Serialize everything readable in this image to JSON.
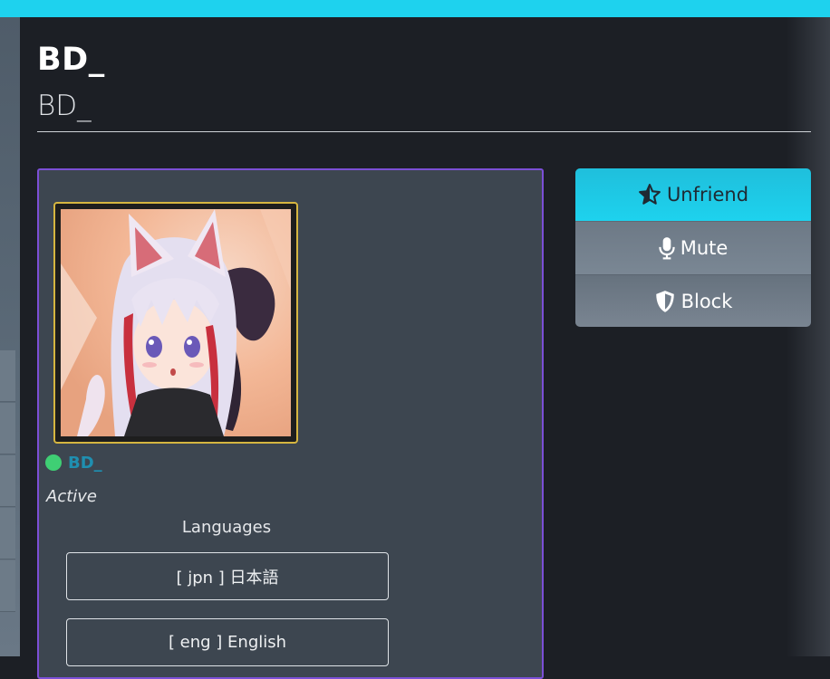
{
  "header": {
    "title": "BD_",
    "subtitle": "BD_"
  },
  "profile": {
    "display_name": "BD_",
    "status": "Active",
    "online_color": "#3fcf74",
    "languages_title": "Languages",
    "languages": [
      "[ jpn ] 日本語",
      "[ eng ] English"
    ]
  },
  "actions": {
    "unfriend_label": "Unfriend",
    "mute_label": "Mute",
    "block_label": "Block"
  },
  "colors": {
    "accent": "#1ed2ee",
    "card_border": "#7b4fd6",
    "avatar_border": "#d6b640",
    "name": "#1f8fb0"
  }
}
